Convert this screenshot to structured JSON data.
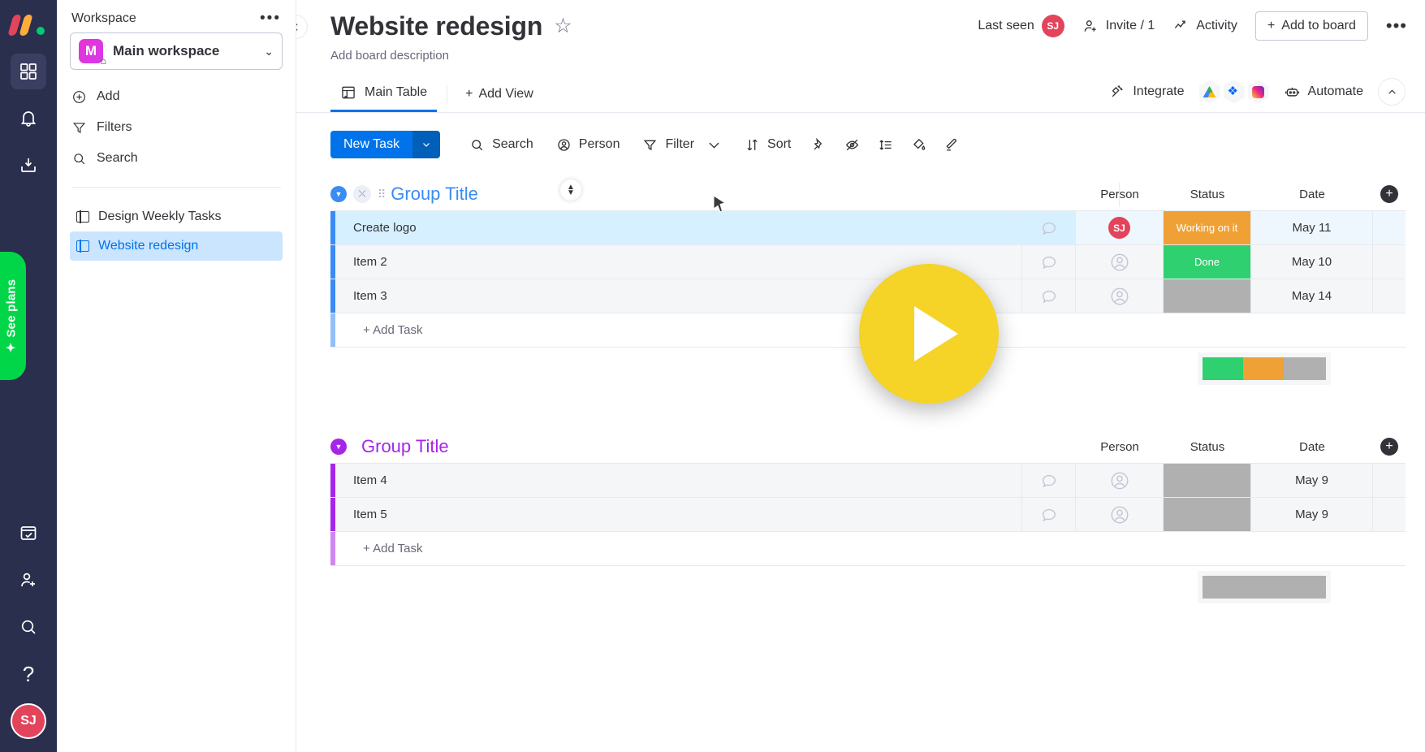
{
  "rail": {
    "logo": "monday-logo",
    "items": [
      {
        "name": "home-grid",
        "icon": "grid-icon",
        "active": true
      },
      {
        "name": "notifications",
        "icon": "bell-icon",
        "active": false
      },
      {
        "name": "inbox",
        "icon": "inbox-download-icon",
        "active": false
      }
    ],
    "see_plans_label": "See plans",
    "bottom_items": [
      {
        "name": "my-work",
        "icon": "calendar-check-icon"
      },
      {
        "name": "invite-members",
        "icon": "person-add-icon"
      },
      {
        "name": "search",
        "icon": "search-icon"
      },
      {
        "name": "help",
        "icon": "question-mark-icon"
      }
    ],
    "avatar_initials": "SJ"
  },
  "sidebar": {
    "header_label": "Workspace",
    "more_menu": "•••",
    "workspace": {
      "badge_letter": "M",
      "name": "Main workspace",
      "chevron": "⌄"
    },
    "menu": [
      {
        "label": "Add",
        "icon": "plus-circle-icon"
      },
      {
        "label": "Filters",
        "icon": "funnel-icon"
      },
      {
        "label": "Search",
        "icon": "search-icon"
      }
    ],
    "boards": [
      {
        "label": "Design Weekly Tasks",
        "selected": false
      },
      {
        "label": "Website redesign",
        "selected": true
      }
    ]
  },
  "header": {
    "collapse_icon": "chevron-left-icon",
    "title": "Website redesign",
    "star_icon": "☆",
    "description": "Add board description",
    "last_seen_label": "Last seen",
    "last_seen_avatar": "SJ",
    "invite_label": "Invite / 1",
    "activity_label": "Activity",
    "add_to_board_label": "Add to board",
    "add_to_board_plus": "+",
    "more_menu": "•••"
  },
  "tabs": {
    "items": [
      {
        "label": "Main Table",
        "icon": "table-home-icon",
        "active": true
      }
    ],
    "add_view_label": "Add View",
    "add_view_plus": "+",
    "integrate_label": "Integrate",
    "integration_icons": [
      "google-drive-icon",
      "dropbox-icon",
      "instagram-icon"
    ],
    "automate_label": "Automate",
    "collapse_chevron": "⌃"
  },
  "toolbar": {
    "new_task_label": "New Task",
    "new_task_chevron": "⌄",
    "search_label": "Search",
    "person_label": "Person",
    "filter_label": "Filter",
    "filter_chevron": "⌄",
    "sort_label": "Sort",
    "icons": [
      "pin-icon",
      "eye-off-icon",
      "row-height-icon",
      "paint-bucket-icon",
      "highlighter-icon"
    ]
  },
  "board": {
    "columns": [
      "Person",
      "Status",
      "Date"
    ],
    "add_column_icon": "+",
    "add_task_label": "+ Add Task",
    "groups": [
      {
        "title": "Group Title",
        "color": "#3a8bf4",
        "rows": [
          {
            "name": "Create logo",
            "person": "SJ",
            "status": "Working on it",
            "status_color": "#f0a135",
            "date": "May 11",
            "selected": true
          },
          {
            "name": "Item 2",
            "person": "",
            "status": "Done",
            "status_color": "#2fd06f",
            "date": "May 10",
            "selected": false
          },
          {
            "name": "Item 3",
            "person": "",
            "status": "",
            "status_color": "#b0b0b0",
            "date": "May 14",
            "selected": false
          }
        ],
        "summary": [
          {
            "color": "#2fd06f",
            "pct": 33
          },
          {
            "color": "#f0a135",
            "pct": 33
          },
          {
            "color": "#b0b0b0",
            "pct": 34
          }
        ]
      },
      {
        "title": "Group Title",
        "color": "#a625e8",
        "rows": [
          {
            "name": "Item 4",
            "person": "",
            "status": "",
            "status_color": "#b0b0b0",
            "date": "May 9",
            "selected": false
          },
          {
            "name": "Item 5",
            "person": "",
            "status": "",
            "status_color": "#b0b0b0",
            "date": "May 9",
            "selected": false
          }
        ],
        "summary": [
          {
            "color": "#b0b0b0",
            "pct": 100
          }
        ]
      }
    ]
  },
  "overlay": {
    "play_button": "play-button",
    "play_color": "#f5d327"
  }
}
